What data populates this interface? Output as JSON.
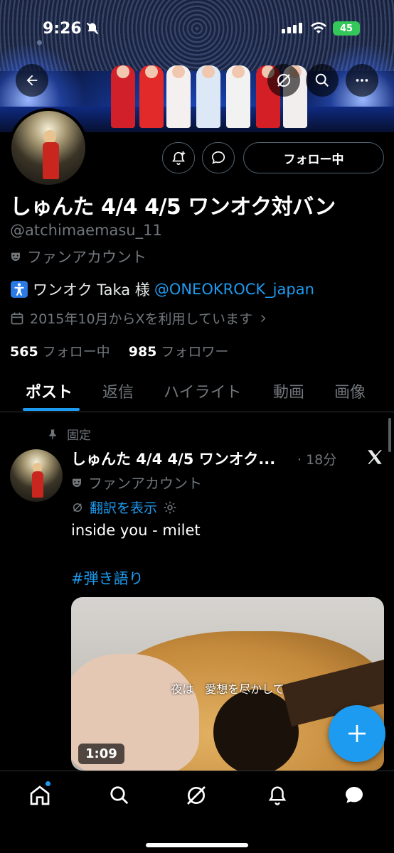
{
  "status_bar": {
    "time": "9:26",
    "battery": "45"
  },
  "profile": {
    "display_name": "しゅんた 4/4 4/5 ワンオク対バン",
    "handle": "@atchimaemasu_11",
    "category": "ファンアカウント",
    "bio_text": "ワンオク Taka 様",
    "bio_link": "@ONEOKROCK_japan",
    "joined": "2015年10月からXを利用しています",
    "following_count": "565",
    "following_label": "フォロー中",
    "followers_count": "985",
    "followers_label": "フォロワー",
    "follow_button": "フォロー中"
  },
  "tabs": [
    "ポスト",
    "返信",
    "ハイライト",
    "動画",
    "画像"
  ],
  "post": {
    "pinned_label": "固定",
    "author": "しゅんた 4/4 4/5 ワンオク...",
    "time": "· 18分",
    "category": "ファンアカウント",
    "translate": "翻訳を表示",
    "text": "inside you - milet",
    "hashtag": "#弾き語り",
    "video_caption": "夜は　愛想を尽かして",
    "video_duration": "1:09"
  },
  "colors": {
    "accent": "#1d9bf0",
    "background": "#000000",
    "muted": "#71767b"
  },
  "icons": {
    "back": "back-arrow-icon",
    "grok": "grok-icon",
    "search": "search-icon",
    "more": "more-icon",
    "notify": "notification-bell-plus-icon",
    "message": "message-bubble-icon",
    "pin": "pin-icon",
    "mask": "theater-mask-icon",
    "calendar": "calendar-icon",
    "x_logo": "x-logo-icon",
    "plus": "plus-icon",
    "home": "home-icon",
    "bell": "bell-icon",
    "chat": "chat-icon"
  }
}
